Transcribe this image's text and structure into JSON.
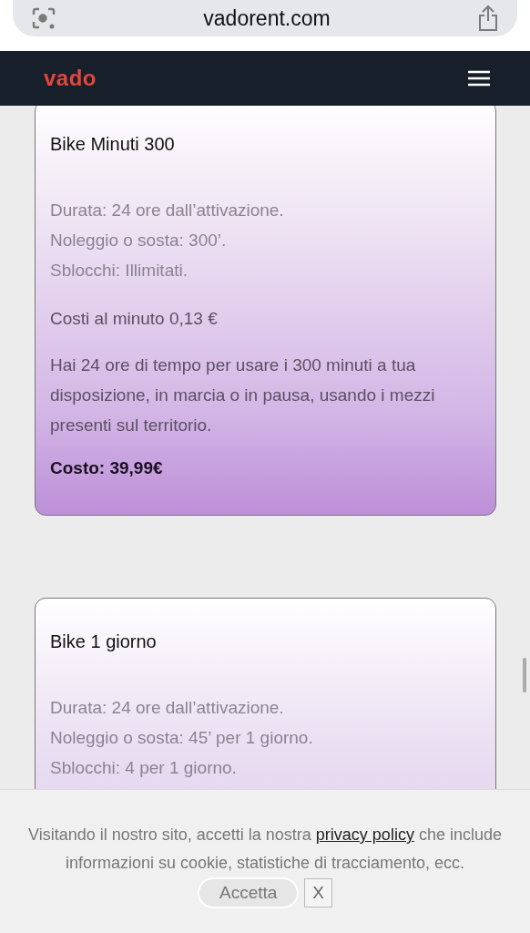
{
  "browser": {
    "url": "vadorent.com"
  },
  "navbar": {
    "logo": "vado"
  },
  "plans": [
    {
      "title": "Bike Minuti 300",
      "details": [
        "Durata: 24 ore dall’attivazione.",
        "Noleggio o sosta: 300’.",
        "Sblocchi: Illimitati."
      ],
      "rate": "Costi al minuto 0,13 €",
      "description": "Hai 24 ore di  tempo per usare i 300 minuti a tua disposizione, in marcia o in pausa, usando i mezzi presenti sul territorio.",
      "price": "Costo: 39,99€"
    },
    {
      "title": "Bike 1 giorno",
      "details": [
        "Durata: 24 ore dall’attivazione.",
        "Noleggio o sosta: 45’ per 1 giorno.",
        "Sblocchi: 4 per 1 giorno."
      ]
    }
  ],
  "cookie_banner": {
    "text_before": "Visitando il nostro sito, accetti la nostra",
    "link": "privacy policy",
    "text_after": "che include informazioni su cookie, statistiche di tracciamento, ecc.",
    "accept_button": "Accetta",
    "close_button": "X"
  }
}
